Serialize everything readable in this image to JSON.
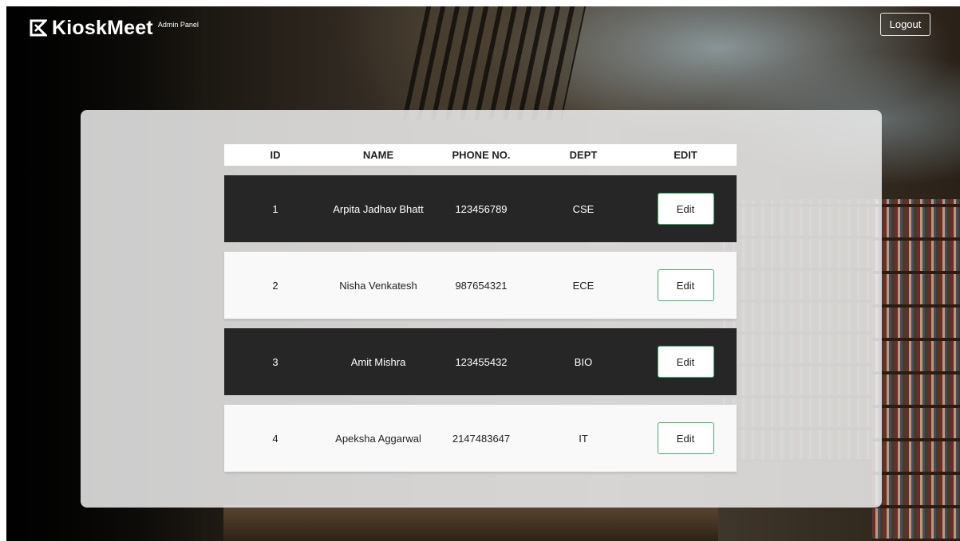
{
  "header": {
    "brand_name": "KioskMeet",
    "brand_sub": "Admin Panel",
    "logout_label": "Logout"
  },
  "table": {
    "columns": [
      "ID",
      "NAME",
      "PHONE NO.",
      "DEPT",
      "EDIT"
    ],
    "rows": [
      {
        "id": "1",
        "name": "Arpita Jadhav Bhatt",
        "phone": "123456789",
        "dept": "CSE",
        "edit_label": "Edit"
      },
      {
        "id": "2",
        "name": "Nisha Venkatesh",
        "phone": "987654321",
        "dept": "ECE",
        "edit_label": "Edit"
      },
      {
        "id": "3",
        "name": "Amit Mishra",
        "phone": "123455432",
        "dept": "BIO",
        "edit_label": "Edit"
      },
      {
        "id": "4",
        "name": "Apeksha Aggarwal",
        "phone": "2147483647",
        "dept": "IT",
        "edit_label": "Edit"
      }
    ]
  },
  "colors": {
    "dark_row": "#262626",
    "light_row": "#f9f9f9",
    "edit_border": "#33b866"
  },
  "icons": {
    "brand": "kioskmeet-logo-icon"
  }
}
